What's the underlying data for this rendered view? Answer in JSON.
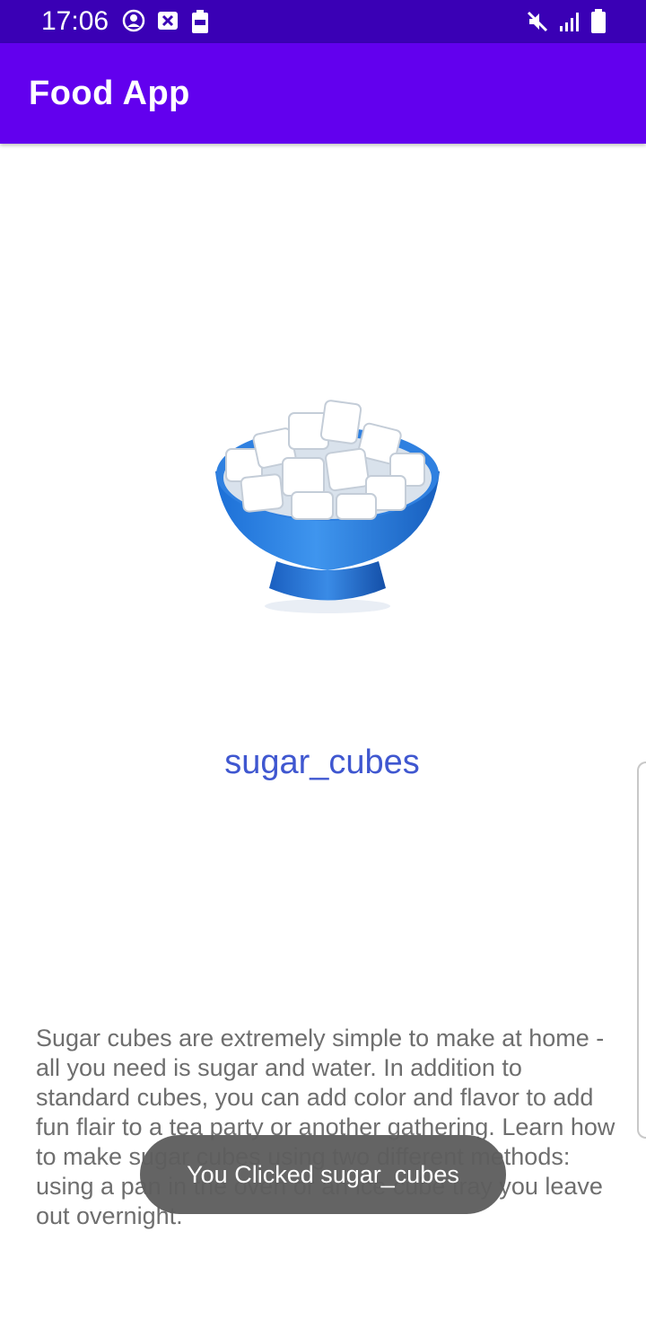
{
  "status_bar": {
    "time": "17:06",
    "left_icons": [
      "account-circle-icon",
      "close-box-icon",
      "battery-saver-icon"
    ],
    "right_icons": [
      "mute-icon",
      "signal-icon",
      "battery-icon"
    ]
  },
  "app_bar": {
    "title": "Food App",
    "color": "#6200ee",
    "status_color": "#3a00b5"
  },
  "food": {
    "image_icon": "sugar-cubes-bowl-icon",
    "name": "sugar_cubes",
    "name_color": "#3f57d0",
    "description": "Sugar cubes are extremely simple to make at home - all you need is sugar and water. In addition to standard cubes, you can add color and flavor to add fun flair to a tea party or another gathering. Learn how to make sugar cubes using two different methods: using a pan in the oven or an ice cube tray you leave out overnight."
  },
  "toast": {
    "message": "You Clicked sugar_cubes"
  }
}
